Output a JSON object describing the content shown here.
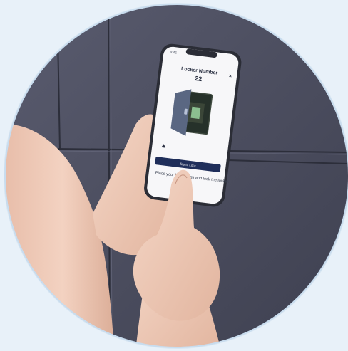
{
  "phone": {
    "status_time": "9:41",
    "locker_label": "Locker Number",
    "locker_number": "22",
    "close_symbol": "×",
    "button_label": "Tap to Lock",
    "instructions": "Place your belongings and lock the locker."
  },
  "colors": {
    "background": "#e8f1f9",
    "wall": "#4a4c5e",
    "accent_button": "#1f2e5a",
    "door": "#5a6782"
  },
  "icons": {
    "close": "close-icon",
    "arrow": "arrow-up-icon",
    "locker": "locker-icon"
  }
}
